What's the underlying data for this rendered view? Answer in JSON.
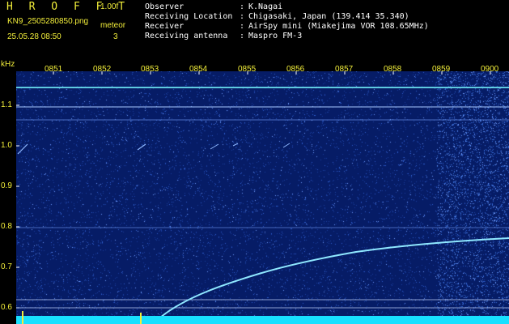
{
  "header": {
    "app_title": "H R O F F T",
    "app_version": "1.00f",
    "file_name": "KN9_2505280850.png",
    "mode_label": "meteor",
    "mode_value": "3",
    "datetime": "25.05.28 08:50",
    "info": [
      {
        "label": "Observer",
        "value": "K.Nagai"
      },
      {
        "label": "Receiving Location",
        "value": "Chigasaki, Japan (139.414 35.340)"
      },
      {
        "label": "Receiver",
        "value": "AirSpy mini (Miakejima VOR 108.65MHz)"
      },
      {
        "label": "Receiving antenna",
        "value": "Maspro FM-3"
      }
    ]
  },
  "spectrogram": {
    "unit_label": "kHz",
    "time_ticks": [
      "0851",
      "0852",
      "0853",
      "0854",
      "0855",
      "0856",
      "0857",
      "0858",
      "0859",
      "0900"
    ],
    "freq_ticks": [
      "1.1",
      "1.0",
      "0.9",
      "0.8",
      "0.7",
      "0.6"
    ],
    "colors": {
      "background": "#061c66",
      "noise": "#3a6fd8",
      "trace": "#8fe8ff",
      "baseline": "#18e0ff",
      "label": "#f2ee3a"
    }
  }
}
